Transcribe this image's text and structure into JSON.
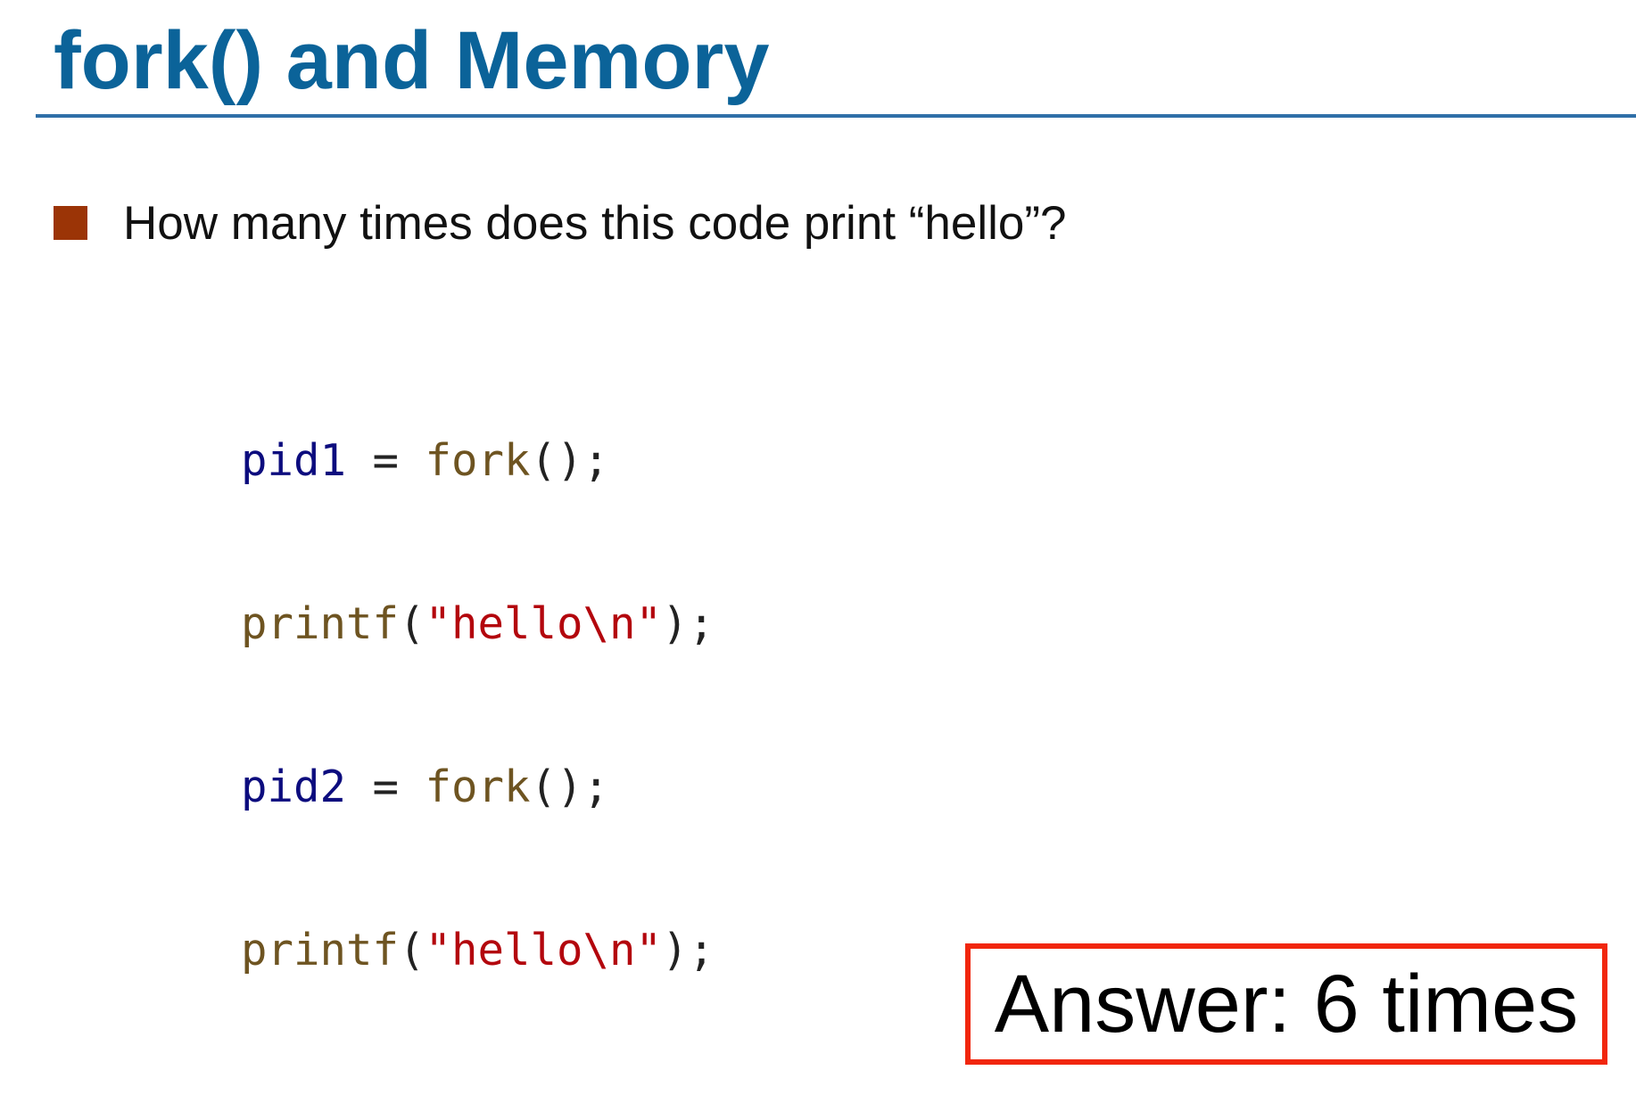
{
  "slide": {
    "title": "fork() and Memory"
  },
  "bullet": {
    "text": "How many times does this code print “hello”?"
  },
  "code": {
    "line1": {
      "var": "pid1",
      "op": " = ",
      "fn": "fork",
      "tail": "();"
    },
    "line2": {
      "fn": "printf",
      "open": "(",
      "str": "\"hello\\n\"",
      "tail": ");"
    },
    "line3": {
      "var": "pid2",
      "op": " = ",
      "fn": "fork",
      "tail": "();"
    },
    "line4": {
      "fn": "printf",
      "open": "(",
      "str": "\"hello\\n\"",
      "tail": ");"
    }
  },
  "answer": {
    "text": "Answer: 6 times"
  },
  "colors": {
    "title": "#0b6399",
    "rule": "#2f6fa8",
    "bullet": "#9b3406",
    "answer_border": "#f1260d",
    "code_variable": "#0c0c7e",
    "code_function": "#6e5421",
    "code_string": "#b3060d"
  }
}
